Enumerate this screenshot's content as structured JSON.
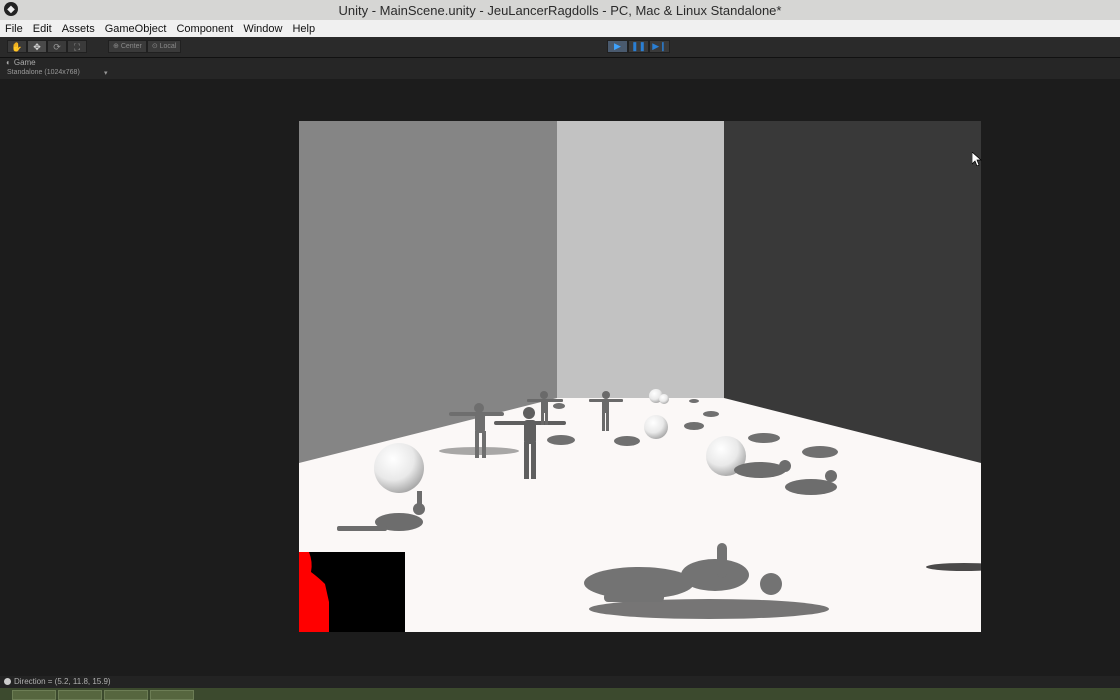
{
  "window": {
    "title": "Unity - MainScene.unity - JeuLancerRagdolls - PC, Mac & Linux Standalone*",
    "icon": "unity-logo-icon"
  },
  "menu": [
    "File",
    "Edit",
    "Assets",
    "GameObject",
    "Component",
    "Window",
    "Help"
  ],
  "toolbar": {
    "transform_tools": [
      "hand-icon",
      "move-icon",
      "rotate-icon",
      "scale-icon"
    ],
    "pivot_label": "Center",
    "space_label": "Local",
    "playback": [
      "play-icon",
      "pause-icon",
      "step-icon"
    ]
  },
  "game_tab": {
    "label": "Game",
    "aspect": "Standalone (1024x768)",
    "aspect_caret": "▾"
  },
  "status": {
    "text": "Direction = (5.2, 11.8, 15.9)"
  },
  "taskbar": {
    "items": [
      "file-explorer-icon",
      "firefox-icon",
      "unity-icon",
      "unity-player-icon"
    ]
  },
  "colors": {
    "editor_bg": "#1c1c1c",
    "floor": "#fbf8f7",
    "wall_left": "#858585",
    "wall_mid": "#c2c2c2",
    "wall_right": "#393939",
    "ragdoll": "#6e6e6e",
    "minimap_red": "#ff0000",
    "play_accent": "#3ea3ff"
  }
}
